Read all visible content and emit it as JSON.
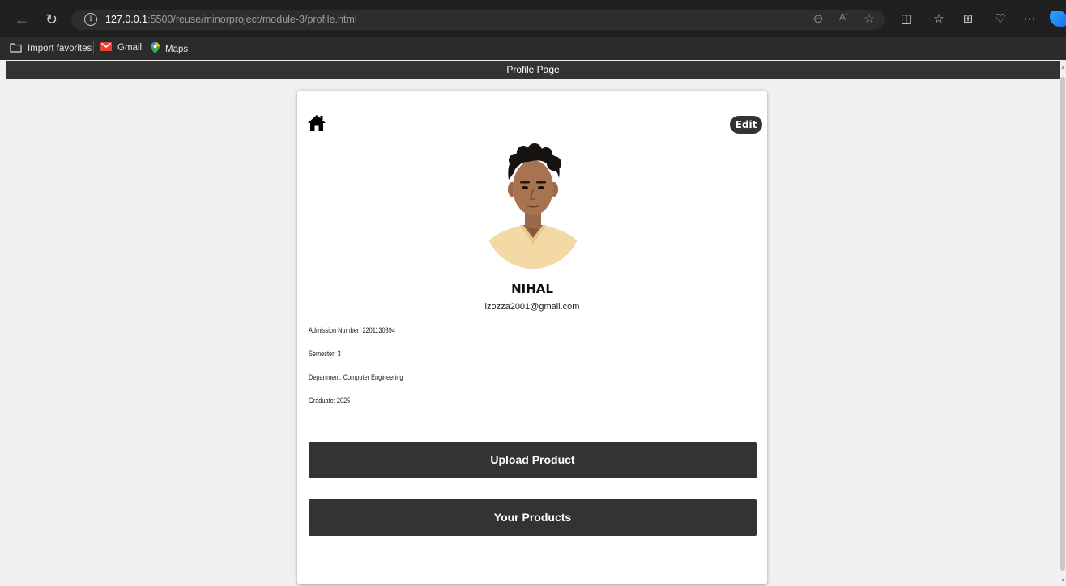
{
  "browser": {
    "url_host": "127.0.0.1",
    "url_rest": ":5500/reuse/minorproject/module-3/profile.html",
    "bookmarks": [
      "Import favorites",
      "Gmail",
      "Maps"
    ]
  },
  "page": {
    "header": "Profile Page",
    "edit_label": "Edit",
    "profile": {
      "name": "NIHAL",
      "email": "izozza2001@gmail.com",
      "admission": "Admission Number: 2201130394",
      "semester": "Semester: 3",
      "department": "Department: Computer Engineering",
      "graduate": "Graduate: 2025"
    },
    "buttons": {
      "upload": "Upload Product",
      "your_products": "Your Products"
    }
  },
  "colors": {
    "dark": "#333333",
    "page_bg": "#f0f0f0",
    "shirt": "#f3d9a4"
  }
}
